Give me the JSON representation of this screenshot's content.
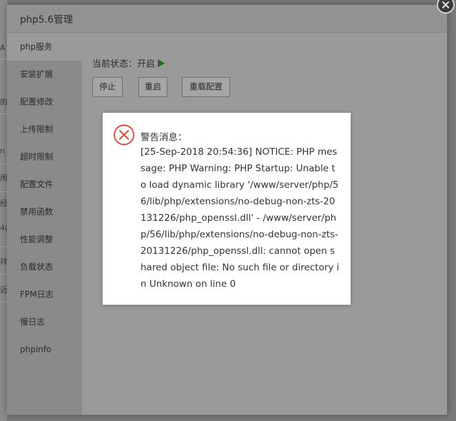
{
  "background": {
    "fragments": [
      "A",
      "的",
      "n",
      "用",
      "经",
      "4(",
      "祥",
      "近"
    ]
  },
  "dialog": {
    "title": "php5.6管理"
  },
  "sidebar": {
    "items": [
      {
        "label": "php服务"
      },
      {
        "label": "安装扩展"
      },
      {
        "label": "配置修改"
      },
      {
        "label": "上传限制"
      },
      {
        "label": "超时限制"
      },
      {
        "label": "配置文件"
      },
      {
        "label": "禁用函数"
      },
      {
        "label": "性能调整"
      },
      {
        "label": "负载状态"
      },
      {
        "label": "FPM日志"
      },
      {
        "label": "慢日志"
      },
      {
        "label": "phpinfo"
      }
    ]
  },
  "service": {
    "status_text": "当前状态：开启",
    "status_icon": "play-icon",
    "status_color": "#1f6f1f",
    "buttons": {
      "stop": "停止",
      "restart": "重启",
      "reload": "重载配置"
    }
  },
  "alert": {
    "icon": "error-circle-icon",
    "icon_color": "#e74c3c",
    "title": "警告消息：",
    "message": "[25-Sep-2018 20:54:36] NOTICE: PHP message: PHP Warning: PHP Startup: Unable to load dynamic library '/www/server/php/56/lib/php/extensions/no-debug-non-zts-20131226/php_openssl.dll' - /www/server/php/56/lib/php/extensions/no-debug-non-zts-20131226/php_openssl.dll: cannot open shared object file: No such file or directory in Unknown on line 0"
  }
}
